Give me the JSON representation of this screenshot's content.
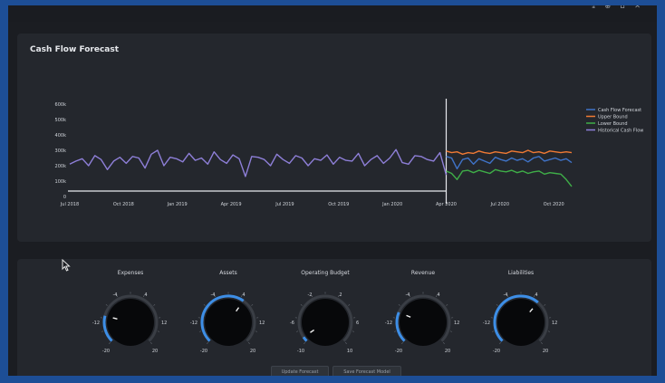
{
  "topbar": {
    "tools": "⤓ ⊕ ⌂ ✕"
  },
  "chart": {
    "title": "Cash Flow Forecast",
    "legend": [
      {
        "name": "Cash Flow Forecast",
        "color": "#3f73c8"
      },
      {
        "name": "Upper Bound",
        "color": "#f07a34"
      },
      {
        "name": "Lower Bound",
        "color": "#3fae48"
      },
      {
        "name": "Historical Cash Flow",
        "color": "#8e7fd8"
      }
    ],
    "yticks": [
      "0",
      "100k",
      "200k",
      "300k",
      "400k",
      "500k",
      "600k"
    ],
    "xticks": [
      "Jul 2018",
      "Oct 2018",
      "Jan 2019",
      "Apr 2019",
      "Jul 2019",
      "Oct 2019",
      "Jan 2020",
      "Apr 2020",
      "Jul 2020",
      "Oct 2020"
    ]
  },
  "chart_data": {
    "type": "line",
    "title": "Cash Flow Forecast",
    "x_range": [
      "Jul 2018",
      "Nov 2020"
    ],
    "ylim": [
      0,
      600000
    ],
    "split_label": "Apr 2020",
    "series": [
      {
        "name": "Historical Cash Flow",
        "color": "#8e7fd8",
        "x_start": "Jul 2018",
        "x_end": "Apr 2020",
        "values": [
          210000,
          230000,
          245000,
          200000,
          265000,
          240000,
          175000,
          230000,
          255000,
          215000,
          260000,
          250000,
          185000,
          275000,
          300000,
          200000,
          255000,
          245000,
          225000,
          280000,
          235000,
          250000,
          210000,
          290000,
          240000,
          215000,
          270000,
          245000,
          130000,
          260000,
          255000,
          240000,
          200000,
          275000,
          240000,
          215000,
          265000,
          250000,
          200000,
          245000,
          235000,
          270000,
          210000,
          255000,
          235000,
          230000,
          280000,
          200000,
          240000,
          265000,
          215000,
          250000,
          305000,
          220000,
          210000,
          265000,
          260000,
          240000,
          230000,
          285000,
          140000
        ]
      },
      {
        "name": "Cash Flow Forecast",
        "color": "#3f73c8",
        "x_start": "Apr 2020",
        "x_end": "Nov 2020",
        "values": [
          260000,
          250000,
          180000,
          240000,
          250000,
          210000,
          245000,
          230000,
          215000,
          255000,
          240000,
          230000,
          250000,
          235000,
          245000,
          225000,
          250000,
          260000,
          230000,
          240000,
          250000,
          235000,
          245000,
          220000
        ]
      },
      {
        "name": "Upper Bound",
        "color": "#f07a34",
        "x_start": "Apr 2020",
        "x_end": "Nov 2020",
        "values": [
          295000,
          285000,
          290000,
          275000,
          285000,
          280000,
          295000,
          285000,
          280000,
          290000,
          285000,
          280000,
          295000,
          290000,
          285000,
          300000,
          285000,
          290000,
          280000,
          295000,
          290000,
          285000,
          290000,
          285000
        ]
      },
      {
        "name": "Lower Bound",
        "color": "#3fae48",
        "x_start": "Apr 2020",
        "x_end": "Nov 2020",
        "values": [
          165000,
          150000,
          110000,
          165000,
          170000,
          155000,
          170000,
          160000,
          150000,
          175000,
          165000,
          160000,
          170000,
          155000,
          165000,
          150000,
          160000,
          165000,
          145000,
          155000,
          150000,
          145000,
          110000,
          65000
        ]
      }
    ]
  },
  "knobs": [
    {
      "title": "Expenses",
      "ticks": {
        "left": "-12",
        "right": "12",
        "tl": "-4",
        "tr": "4",
        "bl": "-20",
        "br": "20"
      },
      "fraction": 0.22
    },
    {
      "title": "Assets",
      "ticks": {
        "left": "-12",
        "right": "12",
        "tl": "-4",
        "tr": "4",
        "bl": "-20",
        "br": "20"
      },
      "fraction": 0.63
    },
    {
      "title": "Operating Budget",
      "ticks": {
        "left": "-6",
        "right": "6",
        "tl": "-2",
        "tr": "2",
        "bl": "-10",
        "br": "10"
      },
      "fraction": 0.04
    },
    {
      "title": "Revenue",
      "ticks": {
        "left": "-12",
        "right": "12",
        "tl": "-4",
        "tr": "4",
        "bl": "-20",
        "br": "20"
      },
      "fraction": 0.25
    },
    {
      "title": "Liabilities",
      "ticks": {
        "left": "-12",
        "right": "12",
        "tl": "-4",
        "tr": "4",
        "bl": "-20",
        "br": "20"
      },
      "fraction": 0.65
    }
  ],
  "buttons": {
    "update": "Update Forecast",
    "save": "Save Forecast Model"
  }
}
